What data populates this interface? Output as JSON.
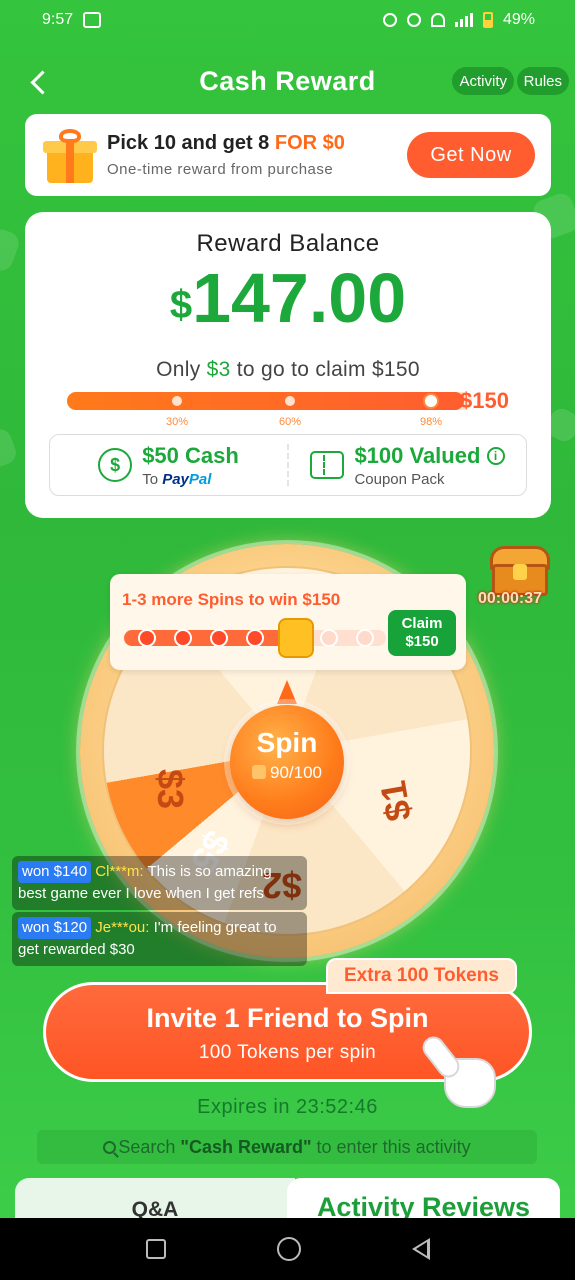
{
  "status_bar": {
    "time": "9:57",
    "battery": "49%"
  },
  "header": {
    "title": "Cash Reward",
    "activity_label": "Activity",
    "rules_label": "Rules"
  },
  "promo": {
    "title_prefix": "Pick 10 and get 8 ",
    "title_highlight": "FOR $0",
    "subtitle": "One-time reward from purchase",
    "button_label": "Get Now"
  },
  "balance": {
    "label": "Reward Balance",
    "currency": "$",
    "amount": "147.00",
    "to_go_prefix": "Only ",
    "to_go_amount": "$3",
    "to_go_suffix": " to go to claim $150",
    "progress_fraction": 0.98,
    "milestones": [
      "30%",
      "60%",
      "98%"
    ],
    "goal_label": "$150",
    "rewards": [
      {
        "main": "$50 Cash",
        "sub_prefix": "To ",
        "sub_brand_a": "Pay",
        "sub_brand_b": "Pal",
        "icon": "dollar-circle-icon"
      },
      {
        "main": "$100 Valued",
        "sub": "Coupon Pack",
        "icon": "coupon-icon"
      }
    ],
    "info_glyph": "i"
  },
  "wheel": {
    "spin_progress_title": "1-3 more Spins to win $150",
    "claim_label_line1": "Claim",
    "claim_label_line2": "$150",
    "segments": [
      "$3",
      "$5",
      "$2",
      "$1"
    ],
    "spin_label": "Spin",
    "spin_tokens": "90/100",
    "timer": "00:00:37",
    "spin_dots_filled": 4,
    "spin_dots_total": 7
  },
  "ticker": [
    {
      "badge": "won $140",
      "user": "Cl***m:",
      "message": " This is so amazing best game ever I love when I get refs"
    },
    {
      "badge": "won $120",
      "user": "Je***ou:",
      "message": " I'm feeling great to get rewarded $30"
    }
  ],
  "invite": {
    "extra_badge": "Extra 100 Tokens",
    "title": "Invite 1 Friend to Spin",
    "subtitle": "100 Tokens per spin"
  },
  "expires": "Expires in 23:52:46",
  "search_hint": {
    "prefix": "Search ",
    "keyword": "\"Cash Reward\"",
    "suffix": " to enter this activity"
  },
  "tabs": {
    "qa": "Q&A",
    "reviews": "Activity Reviews"
  },
  "colors": {
    "brand_green": "#2fb83a",
    "accent_orange": "#ff5d2f",
    "money_green": "#1ca83a"
  }
}
